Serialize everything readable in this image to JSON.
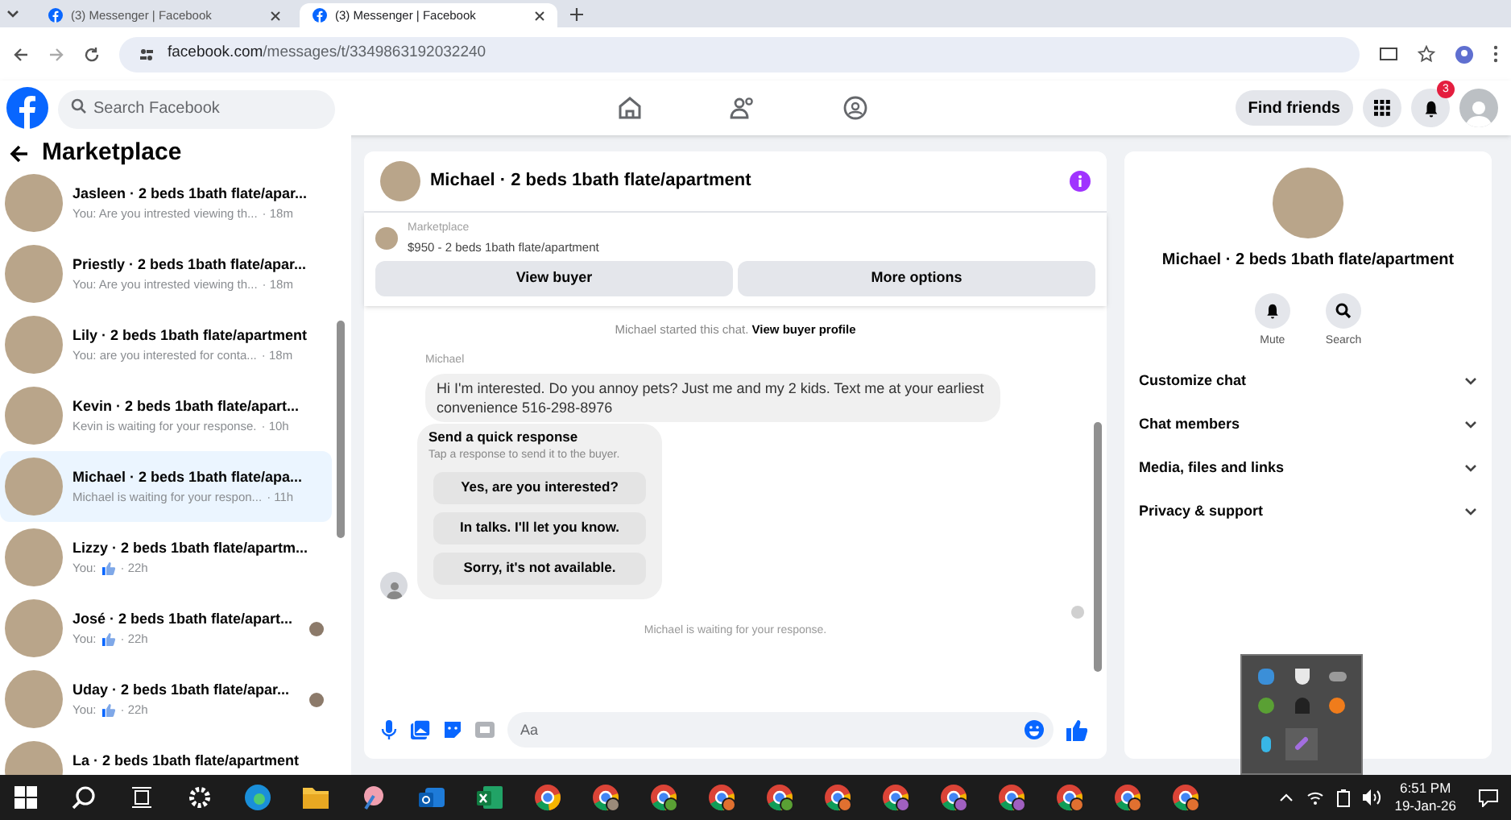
{
  "browser": {
    "tabs": [
      {
        "title": "(3) Messenger | Facebook",
        "selected": false
      },
      {
        "title": "(3) Messenger | Facebook",
        "selected": true
      }
    ],
    "url_host": "facebook.com",
    "url_path": "/messages/t/3349863192032240"
  },
  "header": {
    "search_placeholder": "Search Facebook",
    "find_friends": "Find friends",
    "notification_count": "3"
  },
  "sidebar": {
    "title": "Marketplace",
    "conversations": [
      {
        "name": "Jasleen · 2 beds 1bath flate/apar...",
        "preview": "You: Are you intrested viewing th...",
        "time": "· 18m",
        "like": false,
        "seen": false,
        "selected": false
      },
      {
        "name": "Priestly · 2 beds 1bath flate/apar...",
        "preview": "You: Are you intrested viewing th...",
        "time": "· 18m",
        "like": false,
        "seen": false,
        "selected": false
      },
      {
        "name": "Lily · 2 beds 1bath flate/apartment",
        "preview": "You: are you interested for conta...",
        "time": "· 18m",
        "like": false,
        "seen": false,
        "selected": false
      },
      {
        "name": "Kevin · 2 beds 1bath flate/apart...",
        "preview": "Kevin is waiting for your response.",
        "time": "· 10h",
        "like": false,
        "seen": false,
        "selected": false
      },
      {
        "name": "Michael · 2 beds 1bath flate/apa...",
        "preview": "Michael is waiting for your respon...",
        "time": "· 11h",
        "like": false,
        "seen": false,
        "selected": true
      },
      {
        "name": "Lizzy · 2 beds 1bath flate/apartm...",
        "preview": "You:",
        "time": "· 22h",
        "like": true,
        "seen": false,
        "selected": false
      },
      {
        "name": "José · 2 beds 1bath flate/apart...",
        "preview": "You:",
        "time": "· 22h",
        "like": true,
        "seen": true,
        "selected": false
      },
      {
        "name": "Uday · 2 beds 1bath flate/apar...",
        "preview": "You:",
        "time": "· 22h",
        "like": true,
        "seen": true,
        "selected": false
      },
      {
        "name": "La · 2 beds 1bath flate/apartment",
        "like": false,
        "seen": false,
        "selected": false
      }
    ]
  },
  "chat": {
    "title": "Michael · 2 beds 1bath flate/apartment",
    "listing_label": "Marketplace",
    "listing": "$950 - 2 beds 1bath flate/apartment",
    "buttons": [
      "View buyer",
      "More options"
    ],
    "started": "Michael started this chat.",
    "profile_link": "View buyer profile",
    "sender": "Michael",
    "message": "Hi I'm interested. Do you annoy pets? Just me and my 2 kids.  Text me at your earliest convenience 516-298-8976",
    "quick_title": "Send a quick response",
    "quick_subtitle": "Tap a response to send it to the buyer.",
    "quick_options": [
      "Yes, are you interested?",
      "In talks. I'll let you know.",
      "Sorry, it's not available."
    ],
    "waiting": "Michael is waiting for your response.",
    "composer_placeholder": "Aa"
  },
  "details": {
    "title": "Michael · 2 beds 1bath flate/apartment",
    "actions": [
      {
        "kind": "mute",
        "label": "Mute"
      },
      {
        "kind": "search",
        "label": "Search"
      }
    ],
    "sections": [
      {
        "label": "Customize chat",
        "expanded": false
      },
      {
        "label": "Chat members",
        "expanded": false
      },
      {
        "label": "Media, files and links",
        "expanded": false
      },
      {
        "label": "Privacy & support",
        "expanded": false
      }
    ]
  },
  "taskbar": {
    "time": "6:51 PM",
    "date": "19-Jan-26"
  }
}
